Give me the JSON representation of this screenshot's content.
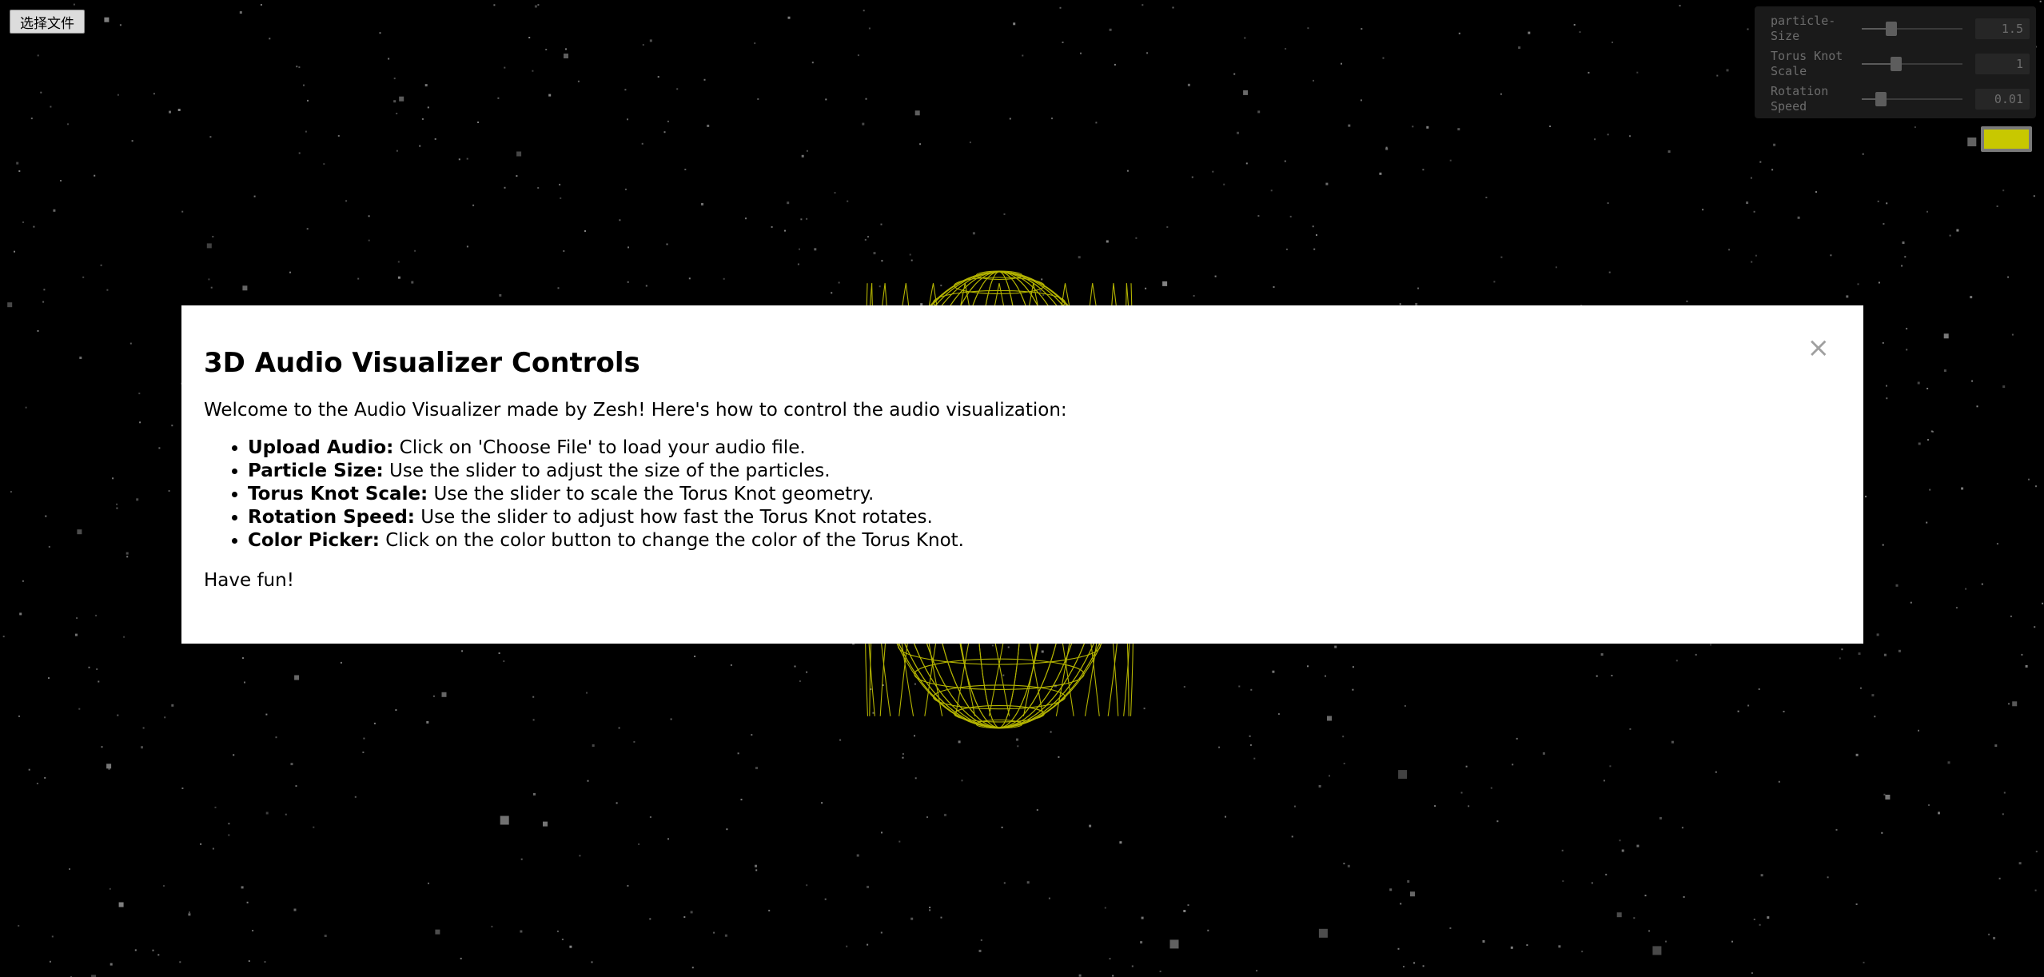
{
  "file_input": {
    "button_label": "选择文件"
  },
  "gui": {
    "controls": [
      {
        "label": "particle-\nSize",
        "value": "1.5",
        "level": 0.28
      },
      {
        "label": "Torus Knot\nScale",
        "value": "1",
        "level": 0.33
      },
      {
        "label": "Rotation\nSpeed",
        "value": "0.01",
        "level": 0.18
      }
    ]
  },
  "color_picker": {
    "color": "#c8c800"
  },
  "modal": {
    "title": "3D Audio Visualizer Controls",
    "close_symbol": "×",
    "intro": "Welcome to the Audio Visualizer made by Zesh! Here's how to control the audio visualization:",
    "items": [
      {
        "term": "Upload Audio:",
        "desc": " Click on 'Choose File' to load your audio file."
      },
      {
        "term": "Particle Size:",
        "desc": " Use the slider to adjust the size of the particles."
      },
      {
        "term": "Torus Knot Scale:",
        "desc": " Use the slider to scale the Torus Knot geometry."
      },
      {
        "term": "Rotation Speed:",
        "desc": " Use the slider to adjust how fast the Torus Knot rotates."
      },
      {
        "term": "Color Picker:",
        "desc": " Click on the color button to change the color of the Torus Knot."
      }
    ],
    "outro": "Have fun!"
  },
  "scene": {
    "wire_color": "#c8c800",
    "star_color": "#8a8a8a"
  }
}
